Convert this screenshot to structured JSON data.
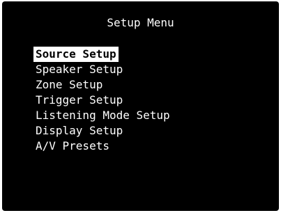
{
  "screen": {
    "title": "Setup Menu",
    "background_color": "#000000",
    "text_color": "#ffffff",
    "highlight_color": "#ffffff"
  },
  "menu": {
    "selected_index": 0,
    "items": [
      {
        "label": "Source Setup"
      },
      {
        "label": "Speaker Setup"
      },
      {
        "label": "Zone Setup"
      },
      {
        "label": "Trigger Setup"
      },
      {
        "label": "Listening Mode Setup"
      },
      {
        "label": "Display Setup"
      },
      {
        "label": "A/V Presets"
      }
    ]
  }
}
